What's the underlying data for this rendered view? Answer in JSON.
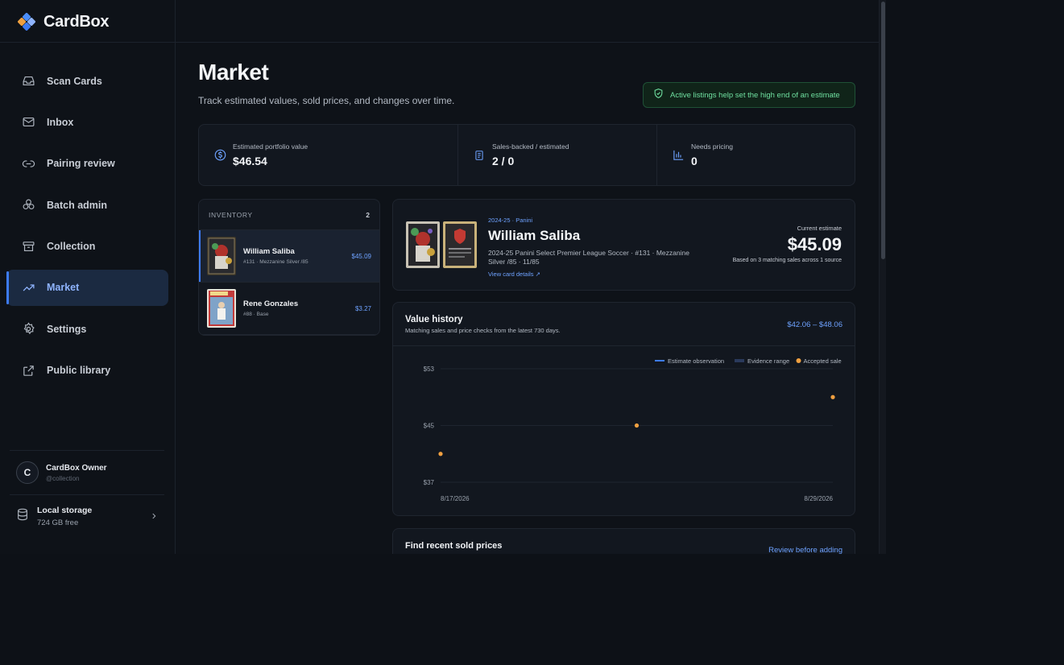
{
  "brand": {
    "name": "CardBox"
  },
  "nav": [
    {
      "label": "Scan Cards",
      "icon": "tray-icon"
    },
    {
      "label": "Inbox",
      "icon": "mail-icon"
    },
    {
      "label": "Pairing review",
      "icon": "link-icon"
    },
    {
      "label": "Batch admin",
      "icon": "boxes-icon"
    },
    {
      "label": "Collection",
      "icon": "archive-icon"
    },
    {
      "label": "Market",
      "icon": "trend-icon",
      "active": true
    },
    {
      "label": "Settings",
      "icon": "gear-icon"
    },
    {
      "label": "Public library",
      "icon": "external-link-icon"
    }
  ],
  "user": {
    "initial": "C",
    "name": "CardBox Owner",
    "handle": "@collection"
  },
  "storage": {
    "label": "Local storage",
    "free": "724 GB free"
  },
  "page": {
    "title": "Market",
    "subtitle": "Track estimated values, sold prices, and changes over time.",
    "notice": "Active listings help set the high end of an estimate"
  },
  "stats": [
    {
      "label": "Estimated portfolio value",
      "value": "$46.54",
      "icon": "dollar-circle-icon"
    },
    {
      "label": "Sales-backed / estimated",
      "value": "2 / 0",
      "icon": "document-icon"
    },
    {
      "label": "Needs pricing",
      "value": "0",
      "icon": "bar-chart-icon"
    }
  ],
  "inventory": {
    "title": "INVENTORY",
    "count": "2",
    "items": [
      {
        "name": "William Saliba",
        "sub": "#131 · Mezzanine Silver /85",
        "price": "$45.09",
        "selected": true
      },
      {
        "name": "Rene Gonzales",
        "sub": "#88 · Base",
        "price": "$3.27"
      }
    ]
  },
  "detail": {
    "set": "2024-25 · Panini",
    "player": "William Saliba",
    "description": "2024-25 Panini Select Premier League Soccer · #131 · Mezzanine Silver /85 · 11/85",
    "link": "View card details ↗",
    "estimate_label": "Current estimate",
    "estimate_value": "$45.09",
    "estimate_note": "Based on 3 matching sales across 1 source"
  },
  "history": {
    "title": "Value history",
    "subtitle": "Matching sales and price checks from the latest 730 days.",
    "range": "$42.06 – $48.06"
  },
  "chart_data": {
    "type": "scatter",
    "legend": [
      {
        "name": "Estimate observation",
        "color": "#3d7bf5",
        "marker": "line"
      },
      {
        "name": "Evidence range",
        "color": "#2a3a5c",
        "marker": "band"
      },
      {
        "name": "Accepted sale",
        "color": "#f0a040",
        "marker": "dot"
      }
    ],
    "legend_position": "top-right",
    "y_ticks": [
      "$53",
      "$45",
      "$37"
    ],
    "y_tick_values": [
      53,
      45,
      37
    ],
    "x_ticks": [
      "8/17/2026",
      "8/29/2026"
    ],
    "ylim": [
      37,
      53
    ],
    "grid": true,
    "series": [
      {
        "name": "Accepted sale",
        "color": "#f0a040",
        "points": [
          {
            "x": 0.0,
            "y": 41.0
          },
          {
            "x": 0.5,
            "y": 45.0
          },
          {
            "x": 1.0,
            "y": 49.0
          }
        ]
      }
    ]
  },
  "sold": {
    "title": "Find recent sold prices",
    "action": "Review before adding"
  },
  "colors": {
    "accent": "#3d7bf5",
    "link": "#6ea2ff",
    "success": "#6fe0a0",
    "sale": "#f0a040"
  }
}
